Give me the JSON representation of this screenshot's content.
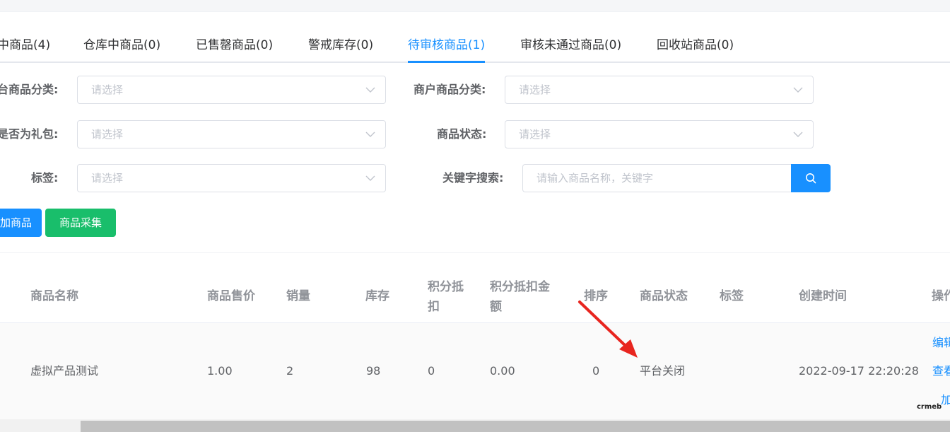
{
  "tabs": [
    {
      "label": "中商品(4)",
      "active": false
    },
    {
      "label": "仓库中商品(0)",
      "active": false
    },
    {
      "label": "已售罄商品(0)",
      "active": false
    },
    {
      "label": "警戒库存(0)",
      "active": false
    },
    {
      "label": "待审核商品(1)",
      "active": true
    },
    {
      "label": "审核未通过商品(0)",
      "active": false
    },
    {
      "label": "回收站商品(0)",
      "active": false
    }
  ],
  "filters": {
    "platform_category_label": "台商品分类:",
    "merchant_category_label": "商户商品分类:",
    "is_gift_label": "是否为礼包:",
    "status_label": "商品状态:",
    "tag_label": "标签:",
    "keyword_label": "关键字搜索:",
    "select_placeholder": "请选择",
    "keyword_placeholder": "请输入商品名称，关键字"
  },
  "actions": {
    "add_product": "加商品",
    "collect_product": "商品采集"
  },
  "table": {
    "headers": {
      "name": "商品名称",
      "price": "商品售价",
      "sales": "销量",
      "stock": "库存",
      "points_line1": "积分抵",
      "points_line2": "扣",
      "points_amount_line1": "积分抵扣金",
      "points_amount_line2": "额",
      "sort": "排序",
      "status": "商品状态",
      "tags": "标签",
      "created": "创建时间",
      "ops": "操作"
    },
    "rows": [
      {
        "name": "虚拟产品测试",
        "price": "1.00",
        "sales": "2",
        "stock": "98",
        "points": "0",
        "points_amount": "0.00",
        "sort": "0",
        "status": "平台关闭",
        "tags": "",
        "created": "2022-09-17 22:20:28",
        "op_edit": "编辑",
        "op_view": "查看",
        "op_more": "加"
      }
    ]
  },
  "watermark": "crmeb",
  "colors": {
    "primary": "#1890ff",
    "success": "#19be6b",
    "arrow": "#e8251f"
  }
}
